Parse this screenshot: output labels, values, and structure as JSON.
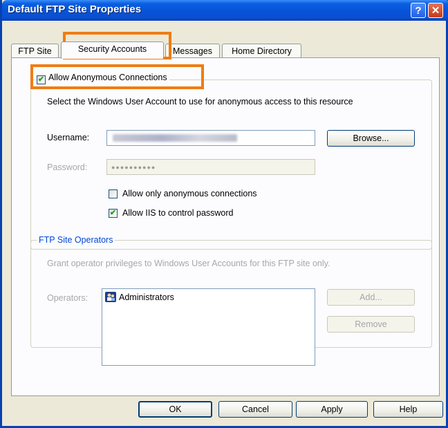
{
  "window": {
    "title": "Default FTP Site Properties",
    "help_glyph": "?",
    "close_glyph": "✕"
  },
  "tabs": [
    {
      "label": "FTP Site"
    },
    {
      "label": "Security Accounts",
      "active": true
    },
    {
      "label": "Messages"
    },
    {
      "label": "Home Directory"
    }
  ],
  "anonymous": {
    "checkbox_label": "Allow Anonymous Connections",
    "checked": true,
    "description": "Select the Windows User Account to use for anonymous access to this resource",
    "username_label": "Username:",
    "password_label": "Password:",
    "password_mask": "●●●●●●●●●●",
    "browse_label": "Browse...",
    "only_anonymous_label": "Allow only anonymous connections",
    "only_anonymous_checked": false,
    "iis_control_label": "Allow IIS to control password",
    "iis_control_checked": true
  },
  "operators": {
    "group_title": "FTP Site Operators",
    "description": "Grant operator privileges to Windows User Accounts for this FTP site only.",
    "operators_label": "Operators:",
    "items": [
      "Administrators"
    ],
    "add_label": "Add...",
    "remove_label": "Remove"
  },
  "footer": {
    "ok_label": "OK",
    "cancel_label": "Cancel",
    "apply_label": "Apply",
    "help_label": "Help"
  },
  "colors": {
    "titlebar": "#0653d9",
    "highlight": "#f07c12",
    "check": "#21a121"
  }
}
